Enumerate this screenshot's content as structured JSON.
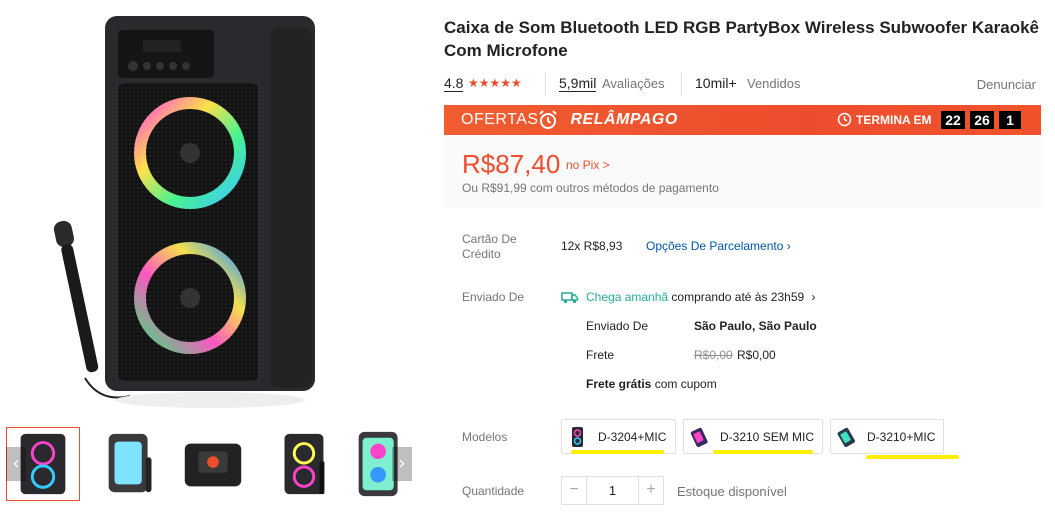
{
  "product": {
    "title": "Caixa de Som Bluetooth LED RGB PartyBox Wireless Subwoofer Karaokê Com Microfone",
    "rating": "4.8",
    "stars": "★★★★★",
    "reviews_count": "5,9mil",
    "reviews_label": "Avaliações",
    "sold_count": "10mil+",
    "sold_label": "Vendidos",
    "report_label": "Denunciar"
  },
  "flash_sale": {
    "title": "OFERTAS",
    "title_bold": "RELÂMPAGO",
    "ends_label": "TERMINA EM",
    "timer": [
      "22",
      "26",
      "1"
    ],
    "accent": "#ee4d2d"
  },
  "price": {
    "value": "R$87,40",
    "pix_label": "no Pix >",
    "other_methods": "Ou R$91,99 com outros métodos de pagamento"
  },
  "credit": {
    "label": "Cartão De Crédito",
    "installments": "12x R$8,93",
    "options_link": "Opções De Parcelamento",
    "chevron": "›"
  },
  "shipping": {
    "label": "Enviado De",
    "arrives": "Chega amanhã",
    "condition": "comprando até às 23h59",
    "chevron": "›",
    "from_label": "Enviado De",
    "from_value": "São Paulo, São Paulo",
    "fee_label": "Frete",
    "fee_old": "R$0,00",
    "fee_new": "R$0,00",
    "free_bold": "Frete grátis",
    "free_rest": "com cupom"
  },
  "models": {
    "label": "Modelos",
    "options": [
      {
        "label": "D-3204+MIC"
      },
      {
        "label": "D-3210 SEM MIC"
      },
      {
        "label": "D-3210+MIC"
      }
    ]
  },
  "quantity": {
    "label": "Quantidade",
    "minus": "−",
    "value": "1",
    "plus": "+",
    "stock": "Estoque disponível"
  },
  "gallery": {
    "prev_icon": "chevron-left-icon",
    "next_icon": "chevron-right-icon",
    "prev_glyph": "‹",
    "next_glyph": "›"
  }
}
